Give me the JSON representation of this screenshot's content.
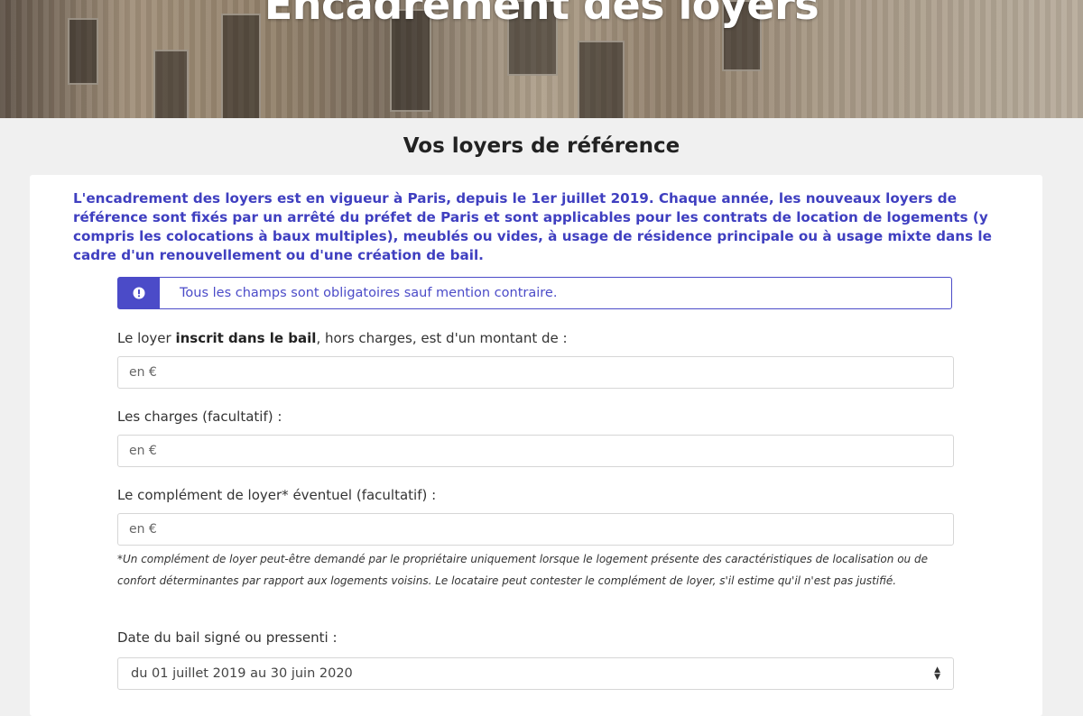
{
  "hero": {
    "title": "Encadrement des loyers"
  },
  "section": {
    "title": "Vos loyers de référence"
  },
  "intro": "L'encadrement des loyers est en vigueur à Paris, depuis le 1er juillet 2019. Chaque année, les nouveaux loyers de référence sont fixés par un arrêté du préfet de Paris et sont applicables pour les contrats de location de logements (y compris les colocations à baux multiples), meublés ou vides, à usage de résidence principale ou à usage mixte dans le cadre d'un renouvellement ou d'une création de bail.",
  "notice": {
    "icon": "exclamation-icon",
    "text": "Tous les champs sont obligatoires sauf mention contraire."
  },
  "form": {
    "rent": {
      "label_before": "Le loyer ",
      "label_bold": "inscrit dans le bail",
      "label_after": ", hors charges, est d'un montant de :",
      "placeholder": "en €",
      "value": ""
    },
    "charges": {
      "label": "Les charges (facultatif) :",
      "placeholder": "en €",
      "value": ""
    },
    "complement": {
      "label": "Le complément de loyer* éventuel (facultatif) :",
      "placeholder": "en €",
      "value": ""
    },
    "footnote": "*Un complément de loyer peut-être demandé par le propriétaire uniquement lorsque le logement présente des caractéristiques de localisation ou de confort déterminantes par rapport aux logements voisins. Le locataire peut contester le complément de loyer, s'il estime qu'il n'est pas justifié.",
    "lease_date": {
      "label": "Date du bail signé ou pressenti :",
      "selected": "du 01 juillet 2019 au 30 juin 2020"
    }
  },
  "colors": {
    "accent": "#4b4bc8",
    "intro_text": "#3f3fc0",
    "page_bg": "#f0f0f0"
  }
}
